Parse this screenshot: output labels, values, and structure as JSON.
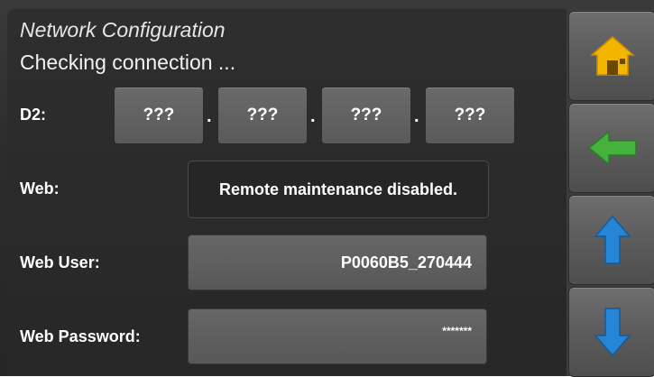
{
  "header": {
    "title": "Network Configuration",
    "status": "Checking connection ..."
  },
  "d2": {
    "label": "D2:",
    "octets": [
      "???",
      "???",
      "???",
      "???"
    ],
    "separator": "."
  },
  "web": {
    "label": "Web:",
    "value": "Remote maintenance disabled."
  },
  "web_user": {
    "label": "Web User:",
    "value": "P0060B5_270444"
  },
  "web_password": {
    "label": "Web Password:",
    "value": "*******"
  },
  "sidebar": {
    "buttons": [
      {
        "icon": "home-icon",
        "color": "#f0b400"
      },
      {
        "icon": "back-arrow-icon",
        "color": "#3fae3a"
      },
      {
        "icon": "arrow-up-icon",
        "color": "#1f7fd0"
      },
      {
        "icon": "arrow-down-icon",
        "color": "#1f7fd0"
      }
    ]
  }
}
